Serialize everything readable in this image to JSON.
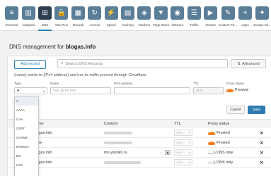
{
  "nav": [
    {
      "label": "Overview",
      "icon": "overview-icon",
      "glyph": "≡"
    },
    {
      "label": "Analytics",
      "icon": "analytics-icon",
      "glyph": "▥"
    },
    {
      "label": "DNS",
      "icon": "dns-icon",
      "glyph": "⊞",
      "active": true
    },
    {
      "label": "SSL/TLS",
      "icon": "lock-icon",
      "glyph": "🔒"
    },
    {
      "label": "Firewall",
      "icon": "firewall-icon",
      "glyph": "▦"
    },
    {
      "label": "Access",
      "icon": "access-icon",
      "glyph": "↻"
    },
    {
      "label": "Speed",
      "icon": "speed-icon",
      "glyph": "⚡"
    },
    {
      "label": "Caching",
      "icon": "caching-icon",
      "glyph": "▤"
    },
    {
      "label": "Workers",
      "icon": "workers-icon",
      "glyph": "◈"
    },
    {
      "label": "Page Rules",
      "icon": "filter-icon",
      "glyph": "▼"
    },
    {
      "label": "Network",
      "icon": "network-icon",
      "glyph": "◉"
    },
    {
      "label": "Traffic",
      "icon": "traffic-icon",
      "glyph": "☰"
    },
    {
      "label": "Stream",
      "icon": "stream-icon",
      "glyph": "▶"
    },
    {
      "label": "Custom Pa...",
      "icon": "custom-pages-icon",
      "glyph": "✎"
    },
    {
      "label": "Apps",
      "icon": "apps-icon",
      "glyph": "+"
    },
    {
      "label": "Scrape Sh...",
      "icon": "scrape-shield-icon",
      "glyph": "✦"
    }
  ],
  "page": {
    "title_prefix": "DNS management for ",
    "domain": "blogas.info"
  },
  "toolbar": {
    "add_label": "Add record",
    "search_placeholder": "Search DNS Records",
    "advanced_label": "Advanced"
  },
  "helptext": "{name} points to {IPv4 address} and has its traffic proxied through Cloudflare.",
  "form": {
    "type_label": "Type",
    "type_value": "A",
    "name_label": "Name",
    "name_placeholder": "Use @ for root",
    "ipv4_label": "IPv4 address",
    "ttl_label": "TTL",
    "ttl_value": "Auto",
    "proxy_label": "Proxy status",
    "proxy_value": "Proxied",
    "cancel_label": "Cancel",
    "save_label": "Save"
  },
  "type_options": [
    "A",
    "AAAA",
    "CAA",
    "CERT",
    "CNAME",
    "DNSKEY",
    "DS",
    "LOC"
  ],
  "table": {
    "headers": {
      "name": "Name",
      "content": "Content",
      "ttl": "TTL",
      "proxy": "Proxy status"
    },
    "rows": [
      {
        "name": "blogas.info",
        "content": "",
        "ttl": "Auto",
        "proxy": "Proxied",
        "proxied": true
      },
      {
        "name": "www",
        "content": "",
        "ttl": "Auto",
        "proxy": "Proxied",
        "proxied": true
      },
      {
        "name": "blogas.info",
        "content": "mx.yandex.ru",
        "ttl": "Auto",
        "proxy": "DNS only",
        "proxied": false
      },
      {
        "name": "blogas.info",
        "content": "",
        "ttl": "Auto",
        "proxy": "DNS only",
        "proxied": false
      }
    ]
  },
  "colors": {
    "accent": "#2c7cb0",
    "proxied": "#f38020",
    "nav_tile": "#5a7d98"
  }
}
